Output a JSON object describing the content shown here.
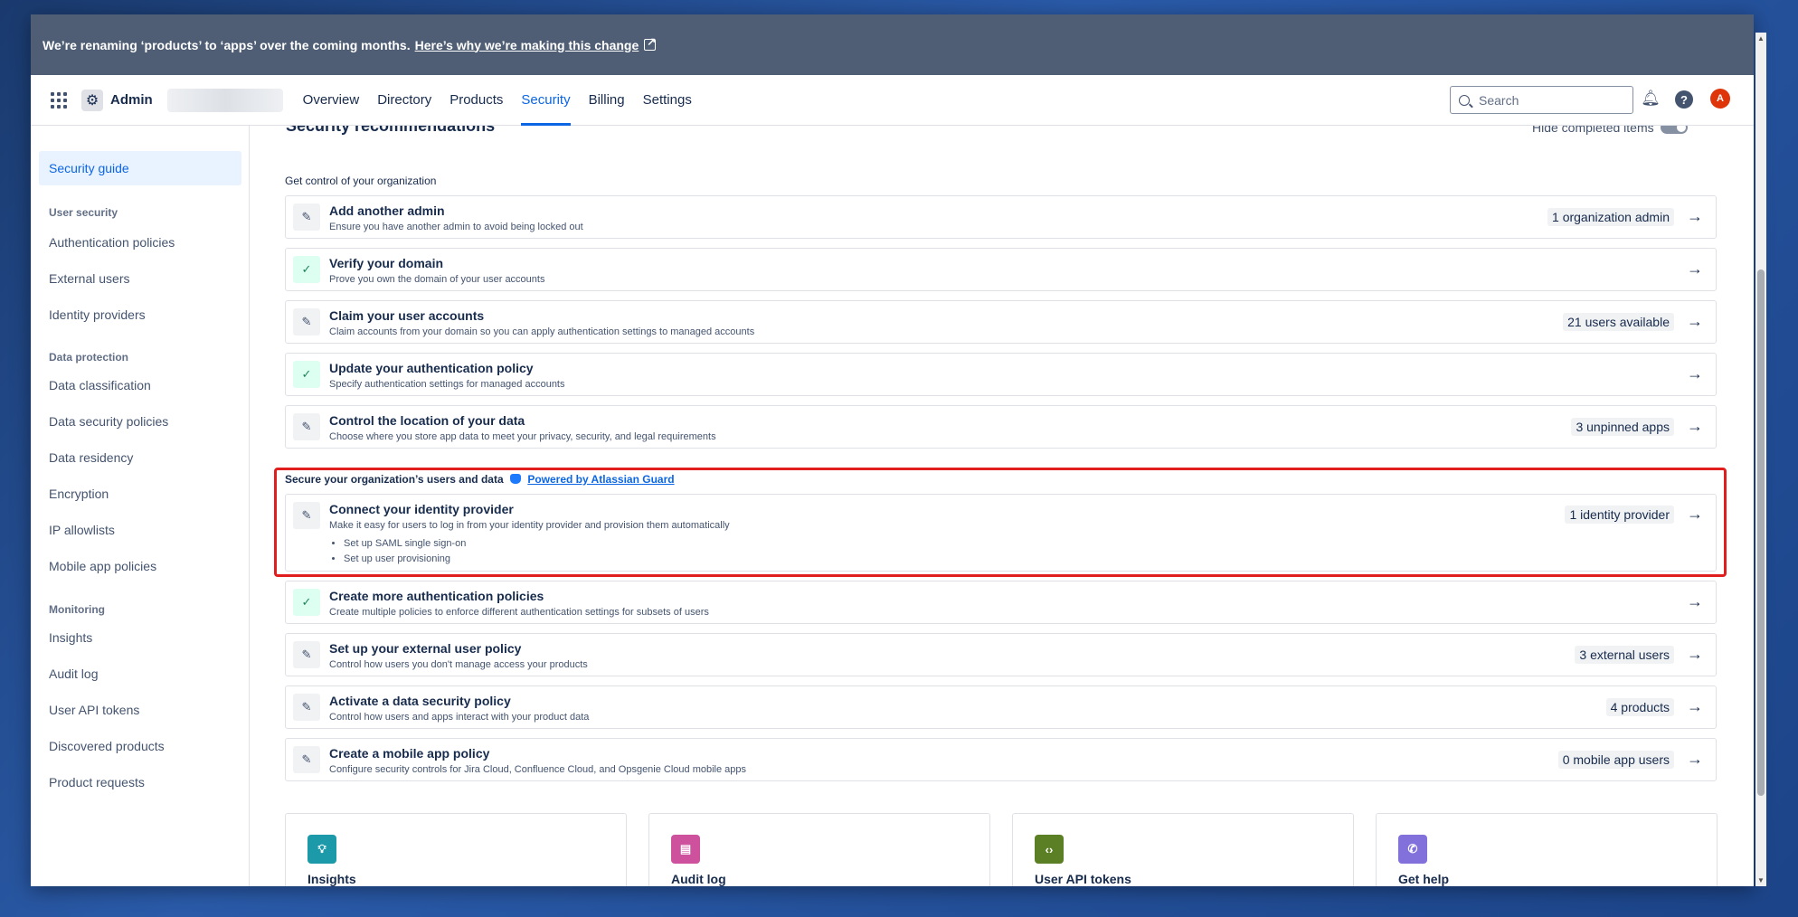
{
  "banner": {
    "text": "We’re renaming ‘products’ to ‘apps’ over the coming months.",
    "link": "Here’s why we’re making this change"
  },
  "topnav": {
    "app_name": "Admin",
    "tabs": [
      "Overview",
      "Directory",
      "Products",
      "Security",
      "Billing",
      "Settings"
    ],
    "active_tab": "Security",
    "search_placeholder": "Search",
    "avatar_initial": "A"
  },
  "sidebar": {
    "active": "Security guide",
    "sections": [
      {
        "heading": "User security",
        "items": [
          "Authentication policies",
          "External users",
          "Identity providers"
        ]
      },
      {
        "heading": "Data protection",
        "items": [
          "Data classification",
          "Data security policies",
          "Data residency",
          "Encryption",
          "IP allowlists",
          "Mobile app policies"
        ]
      },
      {
        "heading": "Monitoring",
        "items": [
          "Insights",
          "Audit log",
          "User API tokens",
          "Discovered products",
          "Product requests"
        ]
      }
    ]
  },
  "main": {
    "section_title": "Security recommendations",
    "hide_completed": "Hide completed items",
    "group1_title": "Get control of your organization",
    "group1_rows": [
      {
        "status": "todo",
        "title": "Add another admin",
        "desc": "Ensure you have another admin to avoid being locked out",
        "badge": "1 organization admin"
      },
      {
        "status": "done",
        "title": "Verify your domain",
        "desc": "Prove you own the domain of your user accounts",
        "badge": ""
      },
      {
        "status": "todo",
        "title": "Claim your user accounts",
        "desc": "Claim accounts from your domain so you can apply authentication settings to managed accounts",
        "badge": "21 users available"
      },
      {
        "status": "done",
        "title": "Update your authentication policy",
        "desc": "Specify authentication settings for managed accounts",
        "badge": ""
      },
      {
        "status": "todo",
        "title": "Control the location of your data",
        "desc": "Choose where you store app data to meet your privacy, security, and legal requirements",
        "badge": "3 unpinned apps"
      }
    ],
    "group2_title": "Secure your organization’s users and data",
    "group2_link": "Powered by Atlassian Guard",
    "identity_row": {
      "title": "Connect your identity provider",
      "desc": "Make it easy for users to log in from your identity provider and provision them automatically",
      "bullets": [
        "Set up SAML single sign-on",
        "Set up user provisioning"
      ],
      "badge": "1 identity provider"
    },
    "group2_rows": [
      {
        "status": "done",
        "title": "Create more authentication policies",
        "desc": "Create multiple policies to enforce different authentication settings for subsets of users",
        "badge": ""
      },
      {
        "status": "todo",
        "title": "Set up your external user policy",
        "desc": "Control how users you don't manage access your products",
        "badge": "3 external users"
      },
      {
        "status": "todo",
        "title": "Activate a data security policy",
        "desc": "Control how users and apps interact with your product data",
        "badge": "4 products"
      },
      {
        "status": "todo",
        "title": "Create a mobile app policy",
        "desc": "Configure security controls for Jira Cloud, Confluence Cloud, and Opsgenie Cloud mobile apps",
        "badge": "0 mobile app users"
      }
    ],
    "cards": [
      {
        "title": "Insights",
        "icon": "lightbulb-icon",
        "color": "#1d9aaa"
      },
      {
        "title": "Audit log",
        "icon": "log-icon",
        "color": "#cd519d"
      },
      {
        "title": "User API tokens",
        "icon": "code-icon",
        "color": "#5b7f24"
      },
      {
        "title": "Get help",
        "icon": "phone-icon",
        "color": "#8270db"
      }
    ]
  },
  "colors": {
    "accent": "#0c66e4",
    "banner_bg": "#4f5e74",
    "highlight": "#e01e1e"
  }
}
